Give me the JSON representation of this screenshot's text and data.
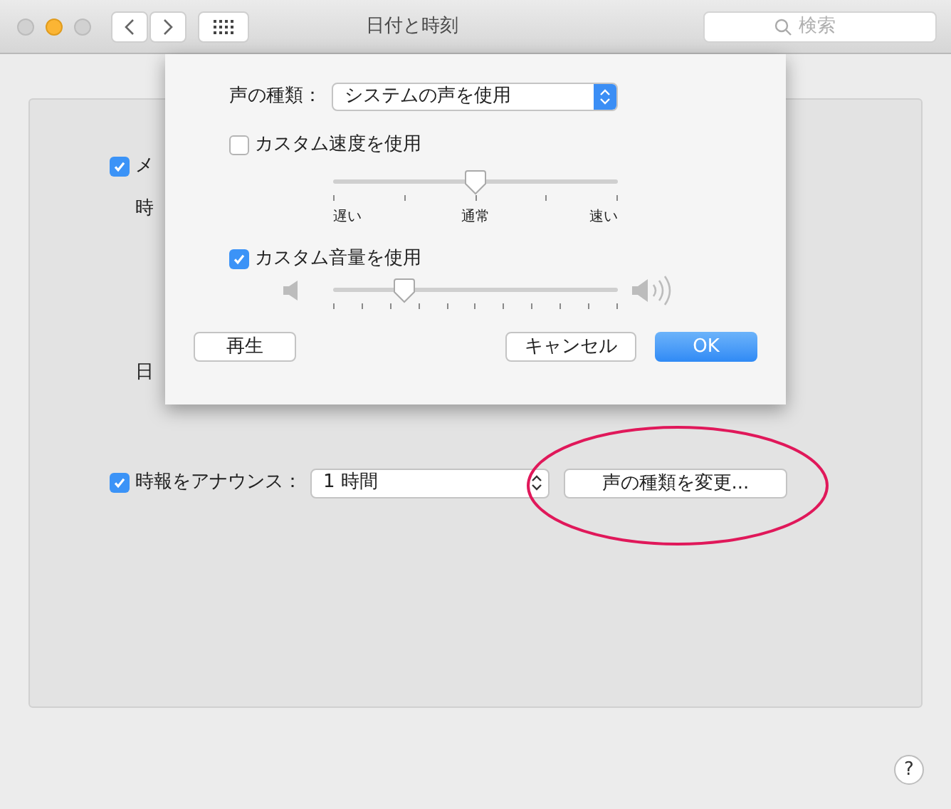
{
  "window": {
    "title": "日付と時刻",
    "search": {
      "placeholder": "検索"
    }
  },
  "background": {
    "menu_checkbox": {
      "label": "メ",
      "checked": true
    },
    "labels": [
      "時",
      "日"
    ],
    "announce": {
      "label": "時報をアナウンス：",
      "checked": true,
      "interval": "1 時間",
      "change_voice_button": "声の種類を変更..."
    }
  },
  "sheet": {
    "voice_label": "声の種類：",
    "voice_value": "システムの声を使用",
    "custom_speed": {
      "label": "カスタム速度を使用",
      "checked": false,
      "level": 0.5,
      "tick_labels": [
        "遅い",
        "通常",
        "速い"
      ]
    },
    "custom_volume": {
      "label": "カスタム音量を使用",
      "checked": true,
      "level": 0.25
    },
    "buttons": [
      {
        "label": "再生",
        "kind": "normal"
      },
      {
        "label": "キャンセル",
        "kind": "normal"
      },
      {
        "label": "OK",
        "kind": "default"
      }
    ]
  },
  "help": "?"
}
